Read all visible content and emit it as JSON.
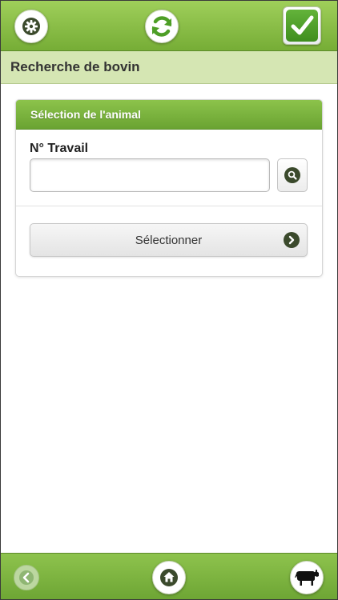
{
  "header": {
    "settings_icon": "gear-icon",
    "sync_icon": "refresh-icon",
    "validate_icon": "checkmark-icon"
  },
  "subheader": {
    "title": "Recherche de bovin"
  },
  "panel": {
    "title": "Sélection de l'animal",
    "field_label": "N° Travail",
    "input_value": "",
    "input_placeholder": "",
    "search_icon": "search-icon",
    "select_button_label": "Sélectionner",
    "select_button_icon": "chevron-right-icon"
  },
  "footer": {
    "back_icon": "back-arrow-icon",
    "home_icon": "home-icon",
    "animal_icon": "cow-icon"
  },
  "colors": {
    "bar_green": "#7fb63d",
    "subheader_bg": "#d5e6b3",
    "icon_dark": "#3b4a2c",
    "validate_green": "#4e9f28"
  }
}
